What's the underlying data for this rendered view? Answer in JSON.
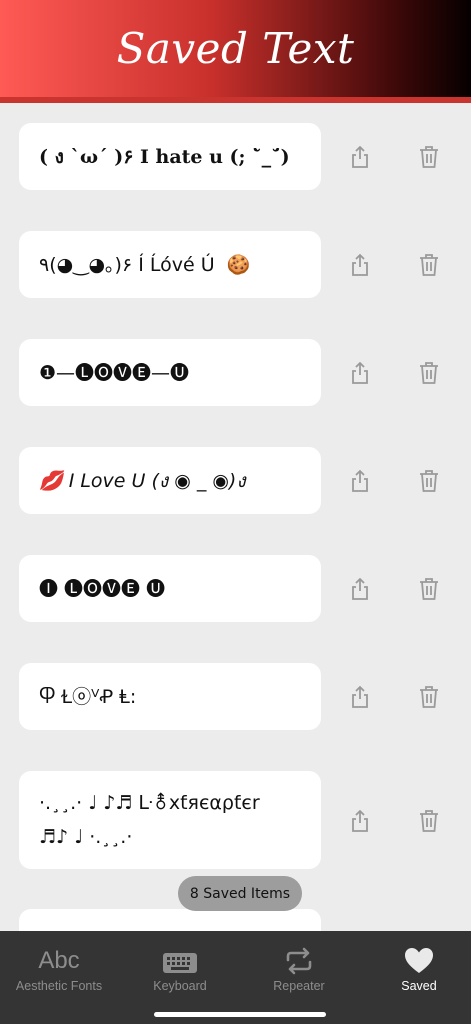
{
  "header": {
    "title": "Saved Text"
  },
  "items": [
    {
      "text": "( ง `ω´ )۶ I hate u (; ˘̀_˘́)",
      "style": "bold"
    },
    {
      "text": "٩(◕‿◕｡)۶ Í Ĺóvé Ú  🍪",
      "style": "normal"
    },
    {
      "text": "❶—🅛🅞🅥🅔—🅤",
      "style": "normal"
    },
    {
      "text": "💋 I Love U (ง ◉ _ ◉)ง",
      "style": "italic"
    },
    {
      "text": "🅘 🅛🅞🅥🅔 🅤",
      "style": "normal"
    },
    {
      "text": "Ⴔ ⱢⓞⱽꝒ Ⱡ:",
      "style": "normal"
    },
    {
      "text": "·.¸¸.· ♩ ♪♬ ᒷ⚨xƭяєαρƭєr\n♬♪ ♩ ·.¸¸.·",
      "style": "normal"
    }
  ],
  "saved_count_label": "8 Saved Items",
  "actions": {
    "share_icon": "share-icon",
    "delete_icon": "trash-icon"
  },
  "tabs": [
    {
      "label": "Aesthetic Fonts",
      "icon": "Abc",
      "active": false
    },
    {
      "label": "Keyboard",
      "icon": "keyboard-icon",
      "active": false
    },
    {
      "label": "Repeater",
      "icon": "repeat-icon",
      "active": false
    },
    {
      "label": "Saved",
      "icon": "heart-icon",
      "active": true
    }
  ],
  "colors": {
    "accent": "#c9342f",
    "tabbar": "#343434",
    "background": "#ececec"
  }
}
